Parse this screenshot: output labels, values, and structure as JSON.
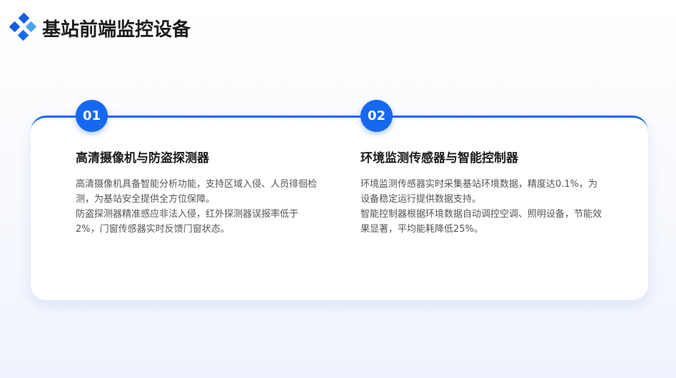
{
  "header": {
    "title": "基站前端监控设备",
    "logo_icon": "diamond-cluster-icon"
  },
  "colors": {
    "accent": "#1668f0",
    "logo_dark": "#0f5fe0",
    "logo_light": "#46a4f5"
  },
  "items": [
    {
      "number": "01",
      "title": "高清摄像机与防盗探测器",
      "paragraphs": [
        "高清摄像机具备智能分析功能，支持区域入侵、人员徘徊检测，为基站安全提供全方位保障。",
        "防盗探测器精准感应非法入侵，红外探测器误报率低于2%，门窗传感器实时反馈门窗状态。"
      ]
    },
    {
      "number": "02",
      "title": "环境监测传感器与智能控制器",
      "paragraphs": [
        "环境监测传感器实时采集基站环境数据，精度达0.1%，为设备稳定运行提供数据支持。",
        "智能控制器根据环境数据自动调控空调、照明设备，节能效果显著，平均能耗降低25%。"
      ]
    }
  ]
}
